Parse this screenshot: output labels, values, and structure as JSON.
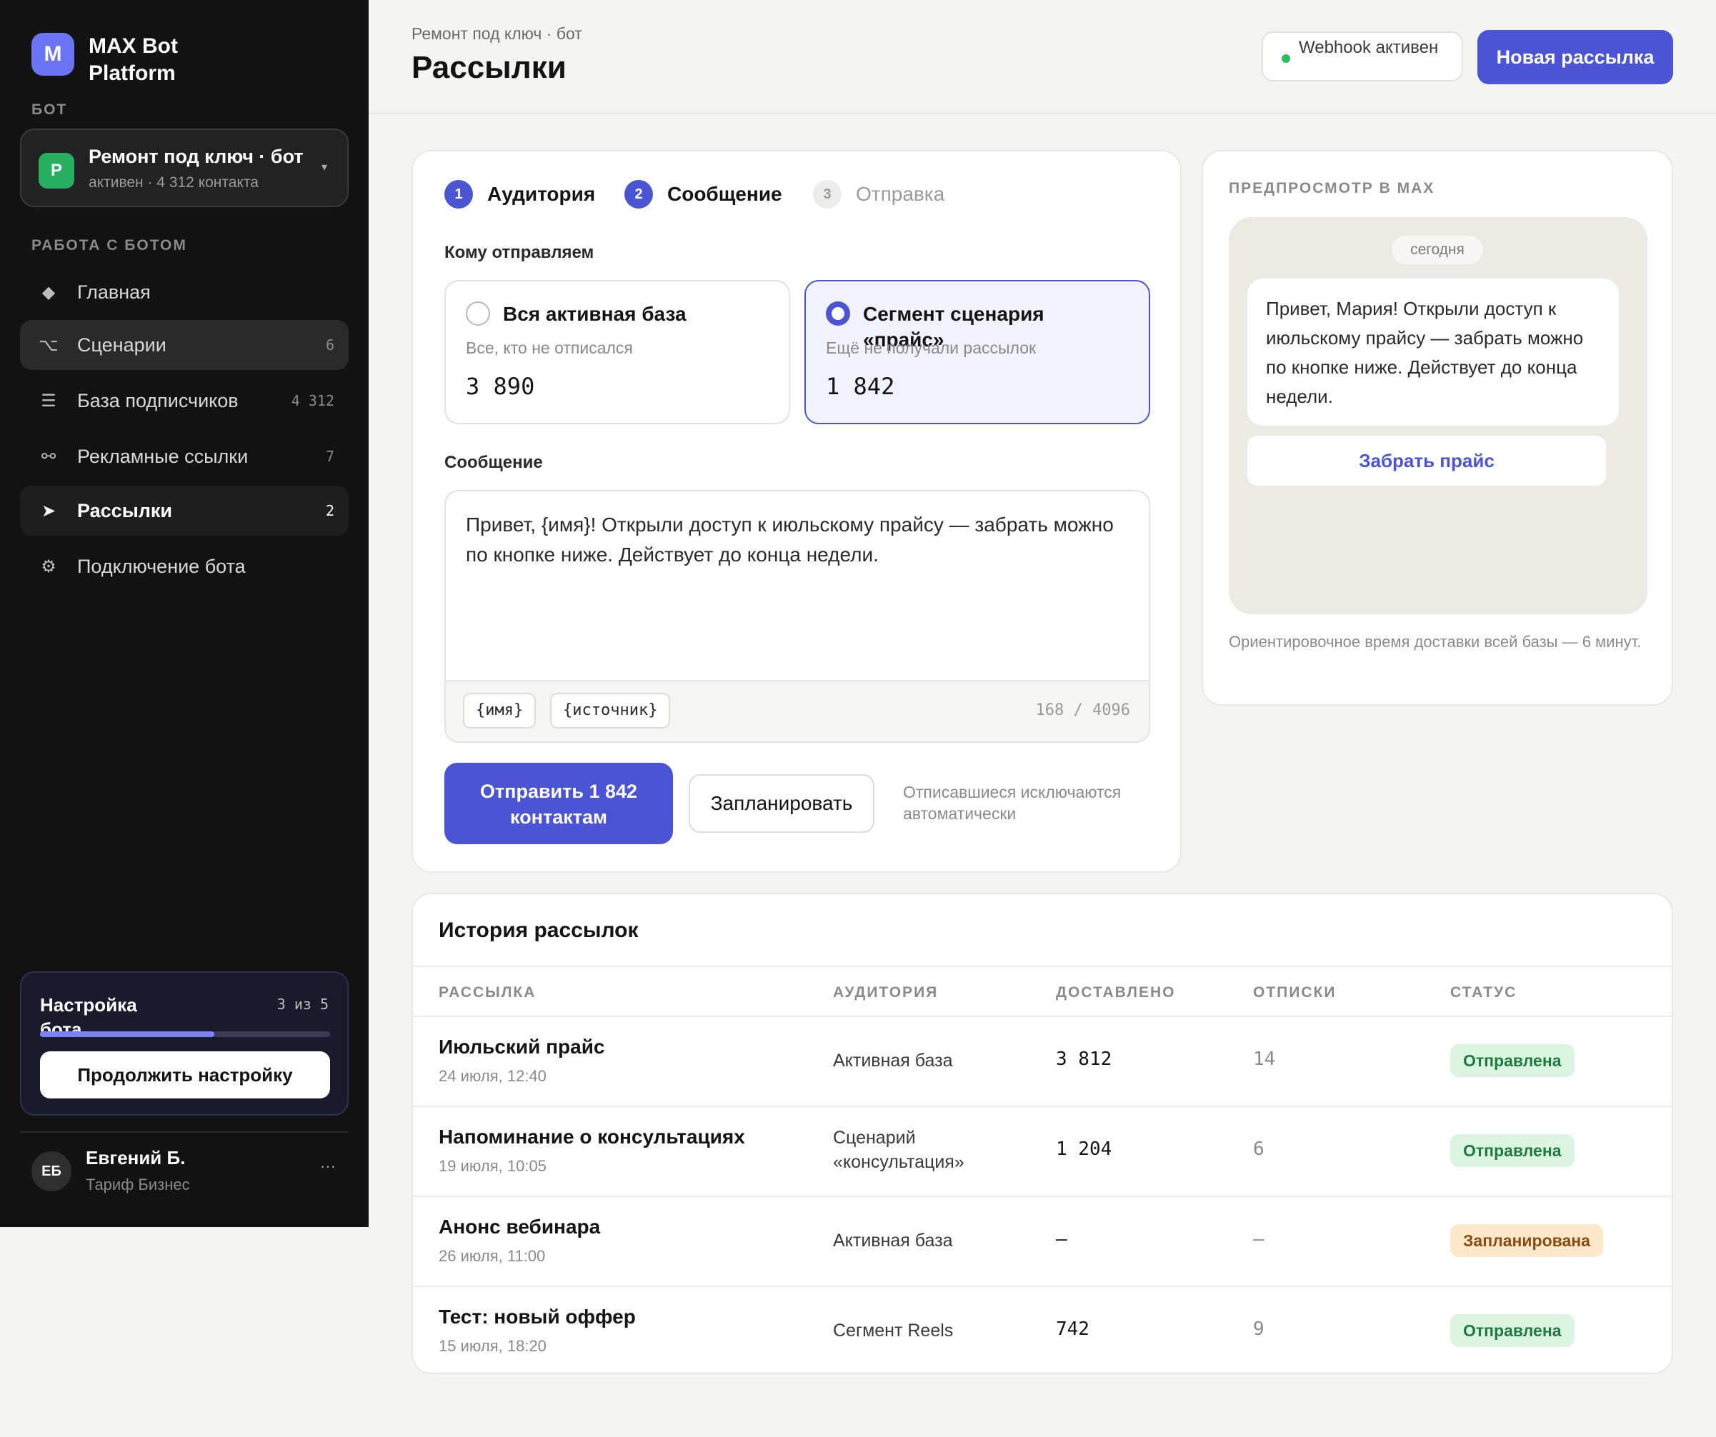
{
  "sidebar": {
    "brand_initial": "M",
    "brand_name": "MAX Bot Platform",
    "bot_section": "БОТ",
    "bot": {
      "initial": "Р",
      "name": "Ремонт под ключ · бот",
      "status": "активен · 4 312 контакта"
    },
    "work_section": "РАБОТА С БОТОМ",
    "items": [
      {
        "icon": "◆",
        "label": "Главная",
        "count": ""
      },
      {
        "icon": "⌥",
        "label": "Сценарии",
        "count": "6"
      },
      {
        "icon": "☰",
        "label": "База подписчиков",
        "count": "4 312"
      },
      {
        "icon": "⚯",
        "label": "Рекламные ссылки",
        "count": "7"
      },
      {
        "icon": "➤",
        "label": "Рассылки",
        "count": "2"
      },
      {
        "icon": "⚙",
        "label": "Подключение бота",
        "count": ""
      }
    ],
    "setup": {
      "title": "Настройка бота",
      "count": "3 из 5",
      "progress": 0.6,
      "button": "Продолжить настройку"
    },
    "user": {
      "initials": "ЕБ",
      "name": "Евгений Б.",
      "plan": "Тариф Бизнес",
      "more": "···"
    }
  },
  "header": {
    "breadcrumb": "Ремонт под ключ · бот",
    "title": "Рассылки",
    "webhook": "Webhook активен",
    "new_button": "Новая рассылка"
  },
  "composer": {
    "steps": [
      {
        "num": "1",
        "label": "Аудитория"
      },
      {
        "num": "2",
        "label": "Сообщение"
      },
      {
        "num": "3",
        "label": "Отправка"
      }
    ],
    "audience_label": "Кому отправляем",
    "audience": [
      {
        "title": "Вся активная база",
        "sub": "Все, кто не отписался",
        "count": "3 890",
        "selected": false
      },
      {
        "title": "Сегмент сценария «прайс»",
        "sub": "Ещё не получали рассылок",
        "count": "1 842",
        "selected": true
      }
    ],
    "message_label": "Сообщение",
    "message": "Привет, {имя}! Открыли доступ к июльскому прайсу — забрать можно по кнопке ниже. Действует до конца недели.",
    "variables": [
      "{имя}",
      "{источник}"
    ],
    "char_count": "168 / 4096",
    "send_button": "Отправить 1 842 контактам",
    "schedule_button": "Запланировать",
    "hint": "Отписавшиеся исключаются автоматически"
  },
  "preview": {
    "title": "ПРЕДПРОСМОТР В MAX",
    "date": "сегодня",
    "bubble": "Привет, Мария! Открыли доступ к июльскому прайсу — забрать можно по кнопке ниже. Действует до конца недели.",
    "button": "Забрать прайс",
    "note": "Ориентировочное время доставки всей базы — 6 минут."
  },
  "history": {
    "title": "История рассылок",
    "columns": [
      "РАССЫЛКА",
      "АУДИТОРИЯ",
      "ДОСТАВЛЕНО",
      "ОТПИСКИ",
      "СТАТУС"
    ],
    "rows": [
      {
        "name": "Июльский прайс",
        "date": "24 июля, 12:40",
        "audience": "Активная база",
        "delivered": "3 812",
        "unsubs": "14",
        "status": "Отправлена"
      },
      {
        "name": "Напоминание о консультациях",
        "date": "19 июля, 10:05",
        "audience": "Сценарий «консультация»",
        "delivered": "1 204",
        "unsubs": "6",
        "status": "Отправлена"
      },
      {
        "name": "Анонс вебинара",
        "date": "26 июля, 11:00",
        "audience": "Активная база",
        "delivered": "—",
        "unsubs": "—",
        "status": "Запланирована"
      },
      {
        "name": "Тест: новый оффер",
        "date": "15 июля, 18:20",
        "audience": "Сегмент Reels",
        "delivered": "742",
        "unsubs": "9",
        "status": "Отправлена"
      }
    ]
  },
  "colors": {
    "accent": "#4b55d4",
    "sidebar": "#121212",
    "success": "#2ebd5f"
  }
}
